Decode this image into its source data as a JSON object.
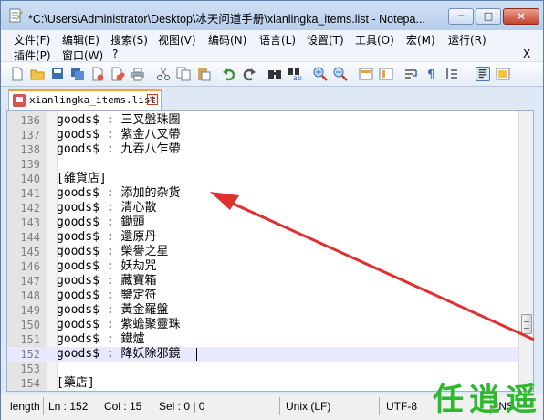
{
  "window": {
    "title": "*C:\\Users\\Administrator\\Desktop\\冰天问道手册\\xianlingka_items.list - Notepa...",
    "min_label": "─",
    "max_label": "□",
    "close_label": "✕"
  },
  "menu": {
    "row1": [
      "文件(F)",
      "编辑(E)",
      "搜索(S)",
      "视图(V)",
      "编码(N)",
      "语言(L)",
      "设置(T)",
      "工具(O)",
      "宏(M)",
      "运行(R)"
    ],
    "row2": [
      "插件(P)",
      "窗口(W)",
      "?"
    ],
    "close_doc": "X"
  },
  "toolbar_icons": [
    "new-file-icon",
    "open-file-icon",
    "save-icon",
    "save-all-icon",
    "close-icon",
    "close-all-icon",
    "print-icon",
    "cut-icon",
    "copy-icon",
    "paste-icon",
    "undo-icon",
    "redo-icon",
    "find-icon",
    "replace-icon",
    "zoom-in-icon",
    "zoom-out-icon",
    "sync-vertical-icon",
    "sync-horizontal-icon",
    "word-wrap-icon",
    "show-all-chars-icon",
    "indent-guide-icon",
    "document-map-icon"
  ],
  "tab": {
    "label": "xianlingka_items.list",
    "close": "✕"
  },
  "editor": {
    "lines": [
      {
        "n": "136",
        "text": "goods$ : 三叉盤珠圈"
      },
      {
        "n": "137",
        "text": "goods$ : 紫金八叉帶"
      },
      {
        "n": "138",
        "text": "goods$ : 九吞八乍帶"
      },
      {
        "n": "139",
        "text": ""
      },
      {
        "n": "140",
        "text": "[雜貨店]"
      },
      {
        "n": "141",
        "text": "goods$ : 添加的杂货"
      },
      {
        "n": "142",
        "text": "goods$ : 清心散"
      },
      {
        "n": "143",
        "text": "goods$ : 鋤頭"
      },
      {
        "n": "144",
        "text": "goods$ : 還原丹"
      },
      {
        "n": "145",
        "text": "goods$ : 榮譽之星"
      },
      {
        "n": "146",
        "text": "goods$ : 妖劫咒"
      },
      {
        "n": "147",
        "text": "goods$ : 藏寶箱"
      },
      {
        "n": "148",
        "text": "goods$ : 鑒定符"
      },
      {
        "n": "149",
        "text": "goods$ : 黃金羅盤"
      },
      {
        "n": "150",
        "text": "goods$ : 紫蟾聚靈珠"
      },
      {
        "n": "151",
        "text": "goods$ : 鐵爐"
      },
      {
        "n": "152",
        "text": "goods$ : 降妖除邪鏡"
      },
      {
        "n": "153",
        "text": ""
      },
      {
        "n": "154",
        "text": "[藥店]"
      }
    ],
    "current_line_index": 16
  },
  "status": {
    "length": "length",
    "ln": "Ln : 152",
    "col": "Col : 15",
    "sel": "Sel : 0 | 0",
    "eol": "Unix (LF)",
    "encoding": "UTF-8",
    "mode": "INS"
  },
  "watermark": "任逍遥",
  "colors": {
    "accent_arrow": "#e03030",
    "tab_top": "#f7a13a",
    "current_line": "#e8e8ff",
    "watermark": "#2eb82e"
  }
}
